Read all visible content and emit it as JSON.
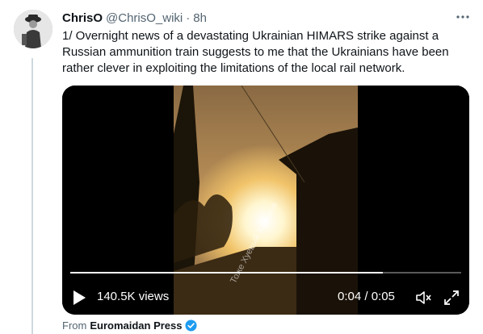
{
  "tweet": {
    "author_name": "ChrisO",
    "author_handle": "@ChrisO_wiki",
    "separator": "·",
    "time": "8h",
    "text": "1/ Overnight news of a devastating Ukrainian HIMARS strike against a Russian ammunition train suggests to me that the Ukrainians have been rather clever in exploiting the limitations of the local rail network."
  },
  "video": {
    "views": "140.5K views",
    "time_display": "0:04 / 0:05",
    "progress": 0.8,
    "watermark": "Тоже Хуевый Харьков"
  },
  "source": {
    "prefix": "From",
    "name": "Euromaidan Press"
  },
  "icons": {
    "more": "more-dots-icon",
    "play": "play-icon",
    "mute": "speaker-muted-icon",
    "fullscreen": "fullscreen-icon",
    "verified": "verified-badge-icon"
  },
  "colors": {
    "text": "#0f1419",
    "secondary": "#536471",
    "verified": "#1d9bf0",
    "thread_line": "#cfd9de"
  }
}
